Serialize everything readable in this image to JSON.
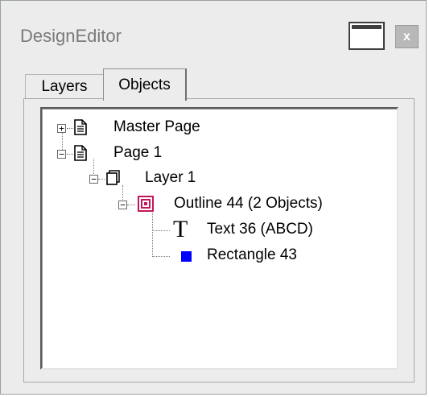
{
  "window": {
    "title": "DesignEditor",
    "close_glyph": "x"
  },
  "tabs": [
    {
      "label": "Layers"
    },
    {
      "label": "Objects"
    }
  ],
  "tree": {
    "master_page": "Master Page",
    "page_1": "Page 1",
    "layer_1": "Layer 1",
    "outline": "Outline 44 (2 Objects)",
    "text": "Text 36 (ABCD)",
    "text_icon_glyph": "T",
    "rectangle": "Rectangle 43"
  },
  "colors": {
    "outline_icon": "#c2185b",
    "rectangle_icon": "#0000ff"
  },
  "icons": {
    "master_page": "page-icon",
    "page_1": "page-icon",
    "layer_1": "layer-icon",
    "outline": "outline-group-icon",
    "text": "text-icon",
    "rectangle": "rectangle-icon"
  }
}
